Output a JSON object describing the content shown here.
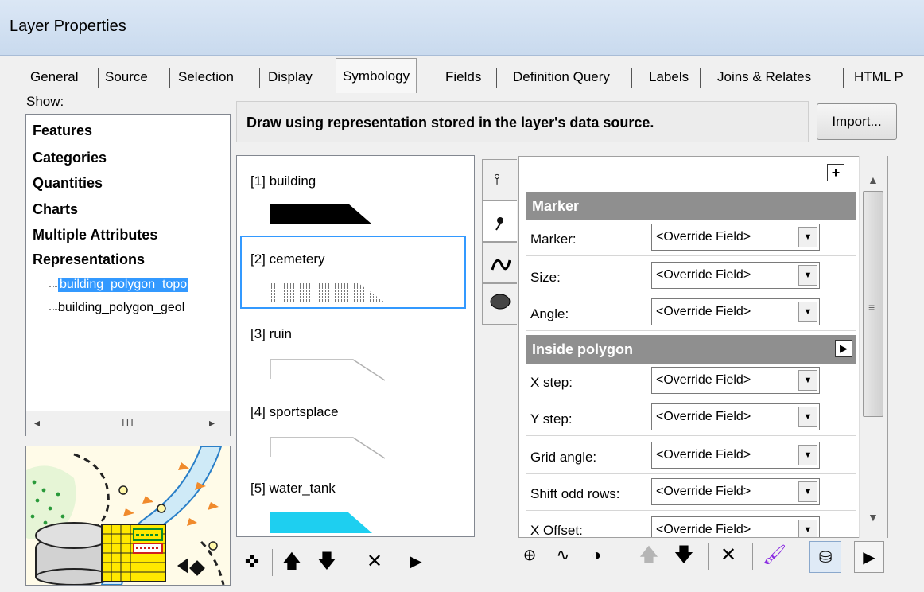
{
  "window": {
    "title": "Layer Properties"
  },
  "tabs": [
    {
      "label": "General"
    },
    {
      "label": "Source"
    },
    {
      "label": "Selection"
    },
    {
      "label": "Display"
    },
    {
      "label": "Symbology",
      "active": true
    },
    {
      "label": "Fields"
    },
    {
      "label": "Definition Query"
    },
    {
      "label": "Labels"
    },
    {
      "label": "Joins & Relates"
    },
    {
      "label": "HTML P"
    }
  ],
  "show": {
    "label_prefix": "S",
    "label_rest": "how:",
    "items": [
      "Features",
      "Categories",
      "Quantities",
      "Charts",
      "Multiple Attributes",
      "Representations"
    ],
    "children": [
      "building_polygon_topo",
      "building_polygon_geol"
    ]
  },
  "description": "Draw using representation stored in the layer's data source.",
  "import_button": {
    "prefix": "I",
    "rest": "mport..."
  },
  "rules": [
    {
      "label": "[1] building",
      "swatch": "#000000"
    },
    {
      "label": "[2] cemetery",
      "swatch": "pattern"
    },
    {
      "label": "[3] ruin",
      "swatch": "outline"
    },
    {
      "label": "[4] sportsplace",
      "swatch": "outline"
    },
    {
      "label": "[5] water_tank",
      "swatch": "#1ecff0"
    }
  ],
  "property_groups": [
    {
      "header": "Marker",
      "rows": [
        {
          "label": "Marker:",
          "value": "<Override Field>"
        },
        {
          "label": "Size:",
          "value": "<Override Field>"
        },
        {
          "label": "Angle:",
          "value": "<Override Field>"
        }
      ]
    },
    {
      "header": "Inside polygon",
      "rows": [
        {
          "label": "X step:",
          "value": "<Override Field>"
        },
        {
          "label": "Y step:",
          "value": "<Override Field>"
        },
        {
          "label": "Grid angle:",
          "value": "<Override Field>"
        },
        {
          "label": "Shift odd rows:",
          "value": "<Override Field>"
        },
        {
          "label": "X Offset:",
          "value": "<Override Field>"
        }
      ]
    }
  ],
  "colors": {
    "selection": "#3399ff",
    "group_header": "#8f8f8f",
    "water_tank": "#1ecff0"
  }
}
